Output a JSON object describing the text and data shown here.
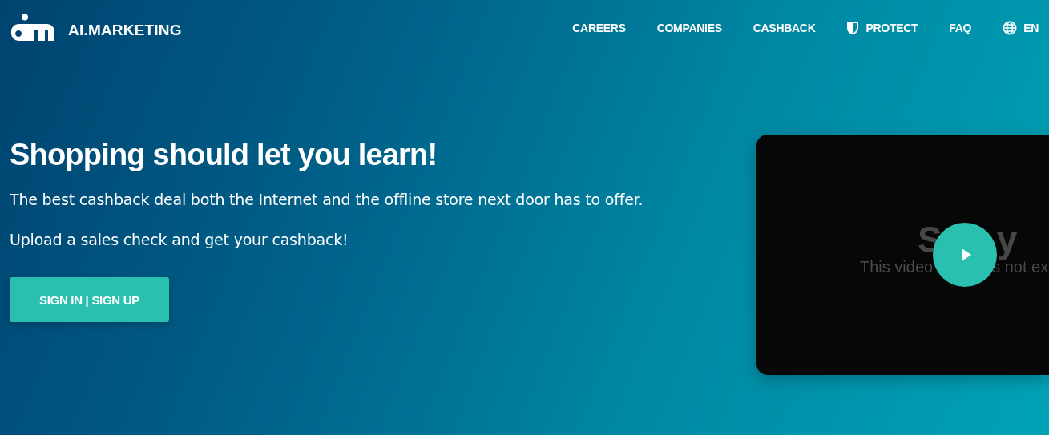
{
  "header": {
    "brand": "AI.MARKETING",
    "nav": [
      {
        "label": "CAREERS",
        "kind": "link"
      },
      {
        "label": "COMPANIES",
        "kind": "link"
      },
      {
        "label": "CASHBACK",
        "kind": "link"
      },
      {
        "label": "PROTECT",
        "kind": "shield"
      },
      {
        "label": "FAQ",
        "kind": "link"
      },
      {
        "label": "EN",
        "kind": "language"
      }
    ]
  },
  "hero": {
    "title": "Shopping should let you learn!",
    "paragraphs": [
      "The best cashback deal both the Internet and the offline store next door has to offer.",
      "Upload a sales check and get your cashback!"
    ],
    "button": "SIGN IN | SIGN UP"
  },
  "video": {
    "error_title_parts": [
      "S",
      "y"
    ],
    "error_message_parts": [
      "This video",
      "s not ex"
    ]
  }
}
